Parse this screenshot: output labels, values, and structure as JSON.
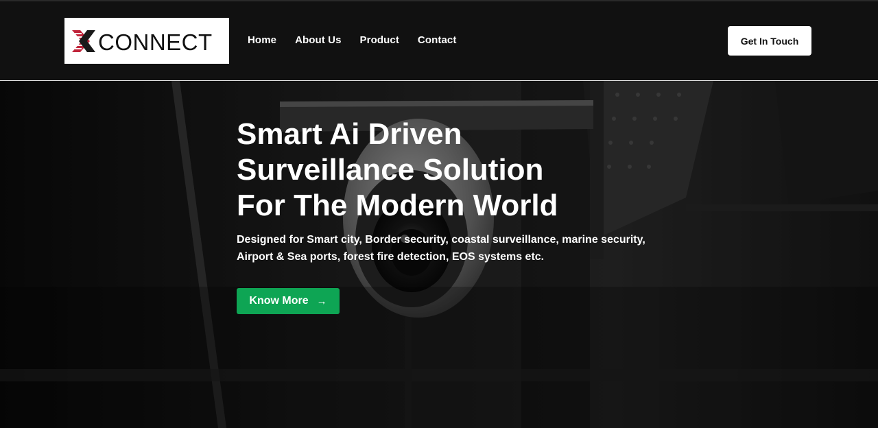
{
  "header": {
    "logo_text": "CONNECT",
    "logo_letter": "X",
    "nav": [
      {
        "label": "Home"
      },
      {
        "label": "About Us"
      },
      {
        "label": "Product"
      },
      {
        "label": "Contact"
      }
    ],
    "cta_label": "Get In Touch"
  },
  "hero": {
    "title_lines": [
      "Smart Ai Driven",
      "Surveillance Solution",
      "For The Modern World"
    ],
    "subtitle_lines": [
      "Designed for Smart city, Border security, coastal surveillance, marine security,",
      "Airport & Sea ports, forest fire detection, EOS systems etc."
    ],
    "button_label": "Know More",
    "button_icon": "arrow-right-icon",
    "background_image": "security-camera-photo"
  },
  "colors": {
    "header_bg": "#111111",
    "cta_bg": "#ffffff",
    "button_green": "#0ea554",
    "logo_accent": "#c0243a",
    "logo_text": "#111111"
  }
}
